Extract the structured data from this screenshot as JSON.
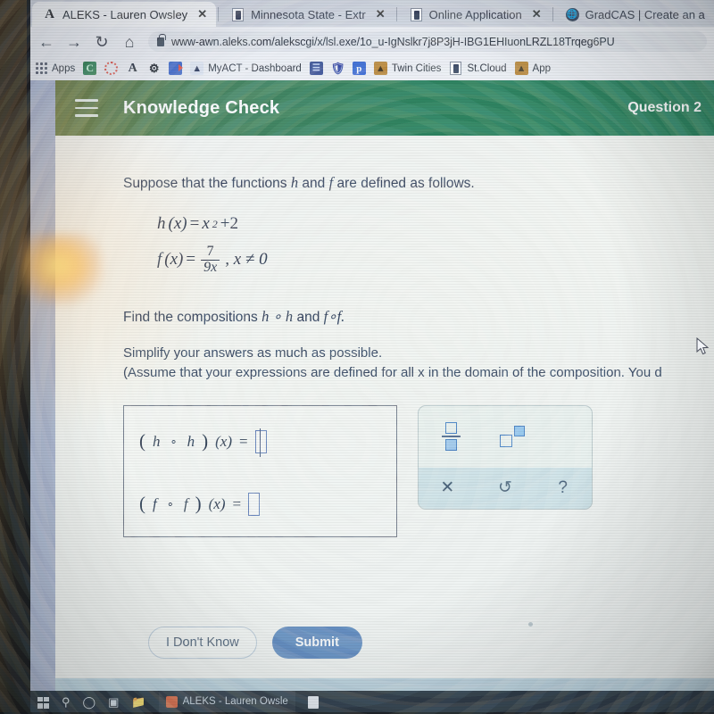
{
  "browser": {
    "tabs": [
      {
        "title": "ALEKS - Lauren Owsley",
        "favicon": "aleks-icon",
        "active": true,
        "close": "✕"
      },
      {
        "title": "Minnesota State - Extr",
        "favicon": "document-icon",
        "active": false,
        "close": "✕"
      },
      {
        "title": "Online Application",
        "favicon": "document-icon",
        "active": false,
        "close": "✕"
      },
      {
        "title": "GradCAS | Create an a",
        "favicon": "globe-icon",
        "active": false,
        "close": ""
      }
    ],
    "nav": {
      "back": "←",
      "forward": "→",
      "reload": "↻",
      "home": "⌂"
    },
    "url": "www-awn.aleks.com/alekscgi/x/lsl.exe/1o_u-IgNslkr7j8P3jH-IBG1EHIuonLRZL18Trqeg6PU",
    "bookmarks": [
      {
        "label": "Apps",
        "icon": "apps-grid-icon"
      },
      {
        "label": "",
        "icon": "canvas-icon"
      },
      {
        "label": "",
        "icon": "dotted-circle-icon"
      },
      {
        "label": "",
        "icon": "letter-a-icon"
      },
      {
        "label": "",
        "icon": "gear-icon"
      },
      {
        "label": "",
        "icon": "video-camera-icon"
      },
      {
        "label": "MyACT - Dashboard",
        "icon": "myact-icon"
      },
      {
        "label": "",
        "icon": "blue-page-icon"
      },
      {
        "label": "",
        "icon": "shield-icon"
      },
      {
        "label": "",
        "icon": "paper-p-icon"
      },
      {
        "label": "Twin Cities",
        "icon": "gopher-icon"
      },
      {
        "label": "St.Cloud",
        "icon": "document-icon"
      },
      {
        "label": "App",
        "icon": "gopher-icon"
      }
    ]
  },
  "aleks": {
    "header": {
      "menu_icon": "hamburger-menu-icon",
      "title": "Knowledge Check",
      "question_label": "Question 2"
    },
    "problem": {
      "intro_pre": "Suppose that the functions ",
      "intro_h": "h",
      "intro_mid": " and ",
      "intro_f": "f",
      "intro_post": " are defined as follows.",
      "h_name": "h",
      "h_arg": "(x)",
      "h_eq": "=",
      "h_base": "x",
      "h_exp": "2",
      "h_plus": "+2",
      "f_name": "f",
      "f_arg": "(x)",
      "f_eq": "=",
      "f_num": "7",
      "f_den": "9x",
      "f_domain": ", x ≠ 0",
      "find_pre": "Find the compositions ",
      "find_c1": "h ∘ h",
      "find_mid": " and ",
      "find_c2": "f∘f.",
      "simplify": "Simplify your answers as much as possible.",
      "assume": "(Assume that your expressions are defined for all x in the domain of the composition. You d"
    },
    "answers": [
      {
        "label_open": "(",
        "fn1": "h",
        "circ": "∘",
        "fn2": "h",
        "label_close": ")",
        "arg": "(x)",
        "eq": "=",
        "value": "",
        "focused": true
      },
      {
        "label_open": "(",
        "fn1": "f",
        "circ": "∘",
        "fn2": "f",
        "label_close": ")",
        "arg": "(x)",
        "eq": "=",
        "value": "",
        "focused": false
      }
    ],
    "palette": {
      "fraction_button": "fraction-icon",
      "exponent_button": "exponent-icon",
      "clear": "✕",
      "undo": "↺",
      "help": "?"
    },
    "footer": {
      "dont_know": "I Don't Know",
      "submit": "Submit"
    },
    "colors": {
      "header_green": "#207a55",
      "submit_blue": "#5a85bd",
      "input_border": "#5d79b5"
    }
  },
  "taskbar": {
    "start": "start-icon",
    "search": "search-icon",
    "cortana": "cortana-icon",
    "task_view": "task-view-icon",
    "file_explorer": "folder-icon",
    "window_title": "ALEKS - Lauren Owsle"
  }
}
